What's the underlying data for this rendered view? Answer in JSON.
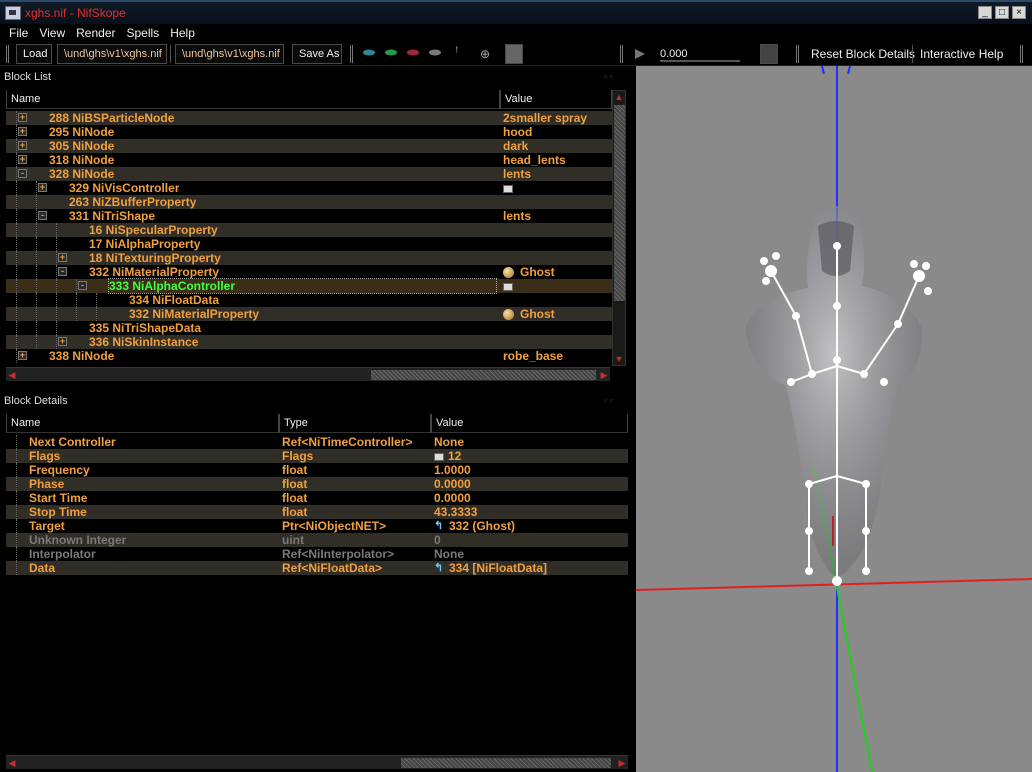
{
  "window": {
    "title": "xghs.nif - NifSkope"
  },
  "menu": [
    "File",
    "View",
    "Render",
    "Spells",
    "Help"
  ],
  "toolbar": {
    "load": "Load",
    "path1": "\\und\\ghs\\v1\\xghs.nif",
    "path2": "\\und\\ghs\\v1\\xghs.nif",
    "save_as": "Save As",
    "time_value": "0.000",
    "reset": "Reset Block Details",
    "help": "Interactive Help"
  },
  "block_list": {
    "title": "Block List",
    "columns": [
      "Name",
      "Value"
    ],
    "rows": [
      {
        "name": "288 NiBSParticleNode",
        "value": "2smaller spray",
        "depth": 0,
        "toggle": "+"
      },
      {
        "name": "295 NiNode",
        "value": "hood",
        "depth": 0,
        "toggle": "+"
      },
      {
        "name": "305 NiNode",
        "value": "dark",
        "depth": 0,
        "toggle": "+"
      },
      {
        "name": "318 NiNode",
        "value": "head_lents",
        "depth": 0,
        "toggle": "+"
      },
      {
        "name": "328 NiNode",
        "value": "lents",
        "depth": 0,
        "toggle": "-"
      },
      {
        "name": "329 NiVisController",
        "value": "",
        "depth": 1,
        "toggle": "+",
        "icon": "flag"
      },
      {
        "name": "263 NiZBufferProperty",
        "value": "",
        "depth": 1,
        "toggle": ""
      },
      {
        "name": "331 NiTriShape",
        "value": "lents",
        "depth": 1,
        "toggle": "-"
      },
      {
        "name": "16 NiSpecularProperty",
        "value": "",
        "depth": 2,
        "toggle": ""
      },
      {
        "name": "17 NiAlphaProperty",
        "value": "",
        "depth": 2,
        "toggle": ""
      },
      {
        "name": "18 NiTexturingProperty",
        "value": "",
        "depth": 2,
        "toggle": "+"
      },
      {
        "name": "332 NiMaterialProperty",
        "value": "Ghost",
        "depth": 2,
        "toggle": "-",
        "icon": "material"
      },
      {
        "name": "333 NiAlphaController",
        "value": "",
        "depth": 3,
        "toggle": "-",
        "icon": "flag",
        "selected": true
      },
      {
        "name": "334 NiFloatData",
        "value": "",
        "depth": 4,
        "toggle": ""
      },
      {
        "name": "332 NiMaterialProperty",
        "value": "Ghost",
        "depth": 4,
        "toggle": "",
        "icon": "material"
      },
      {
        "name": "335 NiTriShapeData",
        "value": "",
        "depth": 2,
        "toggle": ""
      },
      {
        "name": "336 NiSkinInstance",
        "value": "",
        "depth": 2,
        "toggle": "+"
      },
      {
        "name": "338 NiNode",
        "value": "robe_base",
        "depth": 0,
        "toggle": "+"
      }
    ]
  },
  "block_details": {
    "title": "Block Details",
    "columns": [
      "Name",
      "Type",
      "Value"
    ],
    "rows": [
      {
        "name": "Next Controller",
        "type": "Ref<NiTimeController>",
        "value": "None",
        "icon": ""
      },
      {
        "name": "Flags",
        "type": "Flags",
        "value": "12",
        "icon": "flag"
      },
      {
        "name": "Frequency",
        "type": "float",
        "value": "1.0000",
        "icon": ""
      },
      {
        "name": "Phase",
        "type": "float",
        "value": "0.0000",
        "icon": ""
      },
      {
        "name": "Start Time",
        "type": "float",
        "value": "0.0000",
        "icon": ""
      },
      {
        "name": "Stop Time",
        "type": "float",
        "value": "43.3333",
        "icon": ""
      },
      {
        "name": "Target",
        "type": "Ptr<NiObjectNET>",
        "value": "332 (Ghost)",
        "icon": "link"
      },
      {
        "name": "Unknown Integer",
        "type": "uint",
        "value": "0",
        "icon": "",
        "disabled": true
      },
      {
        "name": "Interpolator",
        "type": "Ref<NiInterpolator>",
        "value": "None",
        "icon": "",
        "disabled": true
      },
      {
        "name": "Data",
        "type": "Ref<NiFloatData>",
        "value": "334 [NiFloatData]",
        "icon": "link"
      }
    ]
  },
  "colors": {
    "accent": "#f0a040",
    "selected": "#40ff40",
    "axis_x": "#e02020",
    "axis_y": "#20d020",
    "axis_z": "#2030ff"
  }
}
